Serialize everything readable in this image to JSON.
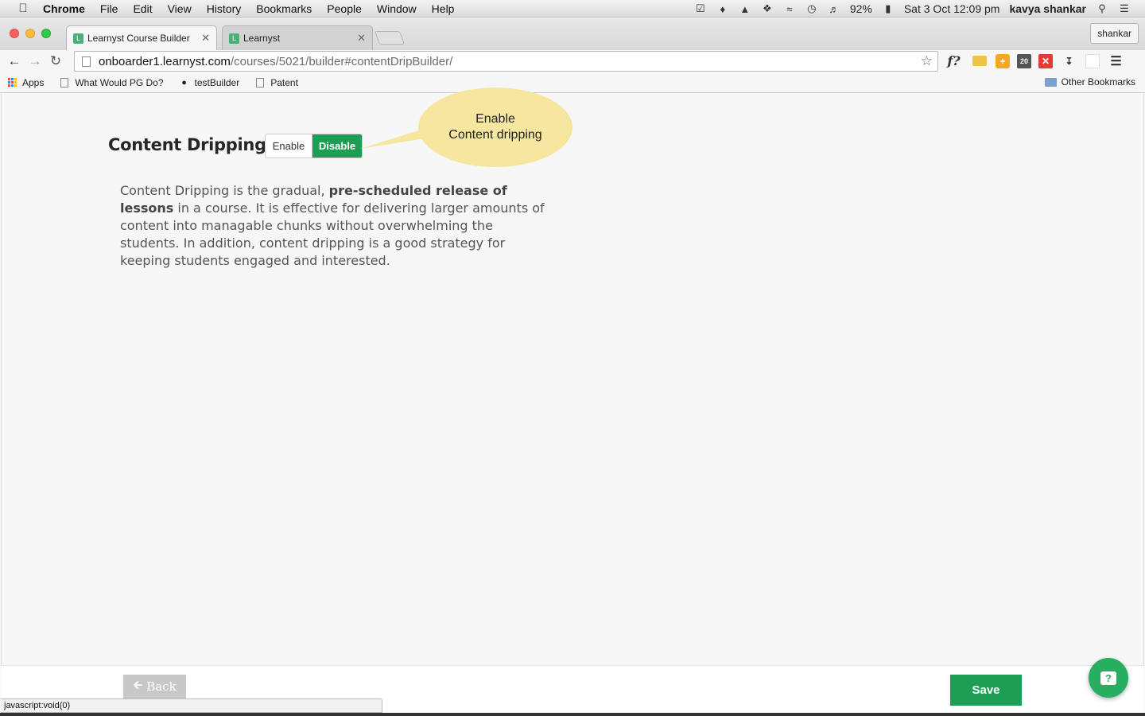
{
  "menubar": {
    "app": "Chrome",
    "items": [
      "File",
      "Edit",
      "View",
      "History",
      "Bookmarks",
      "People",
      "Window",
      "Help"
    ],
    "battery": "92%",
    "datetime": "Sat 3 Oct  12:09 pm",
    "user": "kavya shankar"
  },
  "browser": {
    "tabs": [
      {
        "title": "Learnyst Course Builder",
        "active": true
      },
      {
        "title": "Learnyst",
        "active": false
      }
    ],
    "profile": "shankar",
    "url_host": "onboarder1.learnyst.com",
    "url_path": "/courses/5021/builder#contentDripBuilder/",
    "extensions": {
      "ext_20": "20"
    },
    "bookmarks": [
      "Apps",
      "What Would PG Do?",
      "testBuilder",
      "Patent"
    ],
    "other_bookmarks": "Other Bookmarks"
  },
  "content": {
    "title": "Content Dripping",
    "toggle": {
      "enable": "Enable",
      "disable": "Disable",
      "selected": "Disable"
    },
    "callout": {
      "line1": "Enable",
      "line2": "Content dripping"
    },
    "description_pre": "Content Dripping is the gradual, ",
    "description_bold": "pre-scheduled release of lessons",
    "description_post": " in a course. It is effective for delivering larger amounts of content into managable chunks without overwhelming the students. In addition, content dripping is a good strategy for keeping students engaged and interested."
  },
  "footer": {
    "back_label": "Back",
    "save_label": "Save",
    "help_symbol": "?"
  },
  "status_bar": "javascript:void(0)",
  "colors": {
    "accent_green": "#1e9e55",
    "callout_yellow": "#f5e7a0"
  }
}
